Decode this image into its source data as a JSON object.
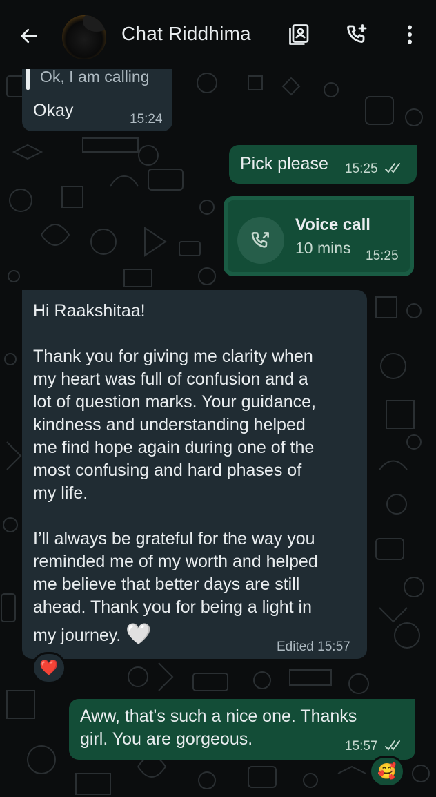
{
  "header": {
    "title": "Chat Riddhima"
  },
  "messages": {
    "m1": {
      "quoted_text": "Ok, I am calling",
      "text": "Okay",
      "time": "15:24"
    },
    "m2": {
      "text": "Pick please",
      "time": "15:25",
      "status": "read"
    },
    "m3": {
      "type": "voice-call",
      "title": "Voice call",
      "duration": "10 mins",
      "time": "15:25"
    },
    "m4": {
      "greeting": "Hi Raakshitaa!",
      "para1_lines": [
        "Thank you for giving me clarity when",
        "my heart was full of confusion and a",
        "lot of question marks. Your guidance,",
        "kindness and understanding helped",
        "me find hope again during one of the",
        "most confusing and hard phases of",
        "my life."
      ],
      "para2_lines": [
        "I’ll always be grateful for the way you",
        "reminded me of my worth and helped",
        "me believe that better days are still",
        "ahead. Thank you for being a light in",
        "my journey."
      ],
      "emoji": "🤍",
      "edited_time": "Edited 15:57",
      "reaction": "❤️"
    },
    "m5": {
      "lines": [
        "Aww, that's such a nice one. Thanks",
        "girl. You are gorgeous."
      ],
      "time": "15:57",
      "status": "delivered",
      "reaction": "🥰"
    }
  },
  "colors": {
    "background": "#0b0d0e",
    "incoming_bubble": "#202c33",
    "outgoing_bubble": "#134d37",
    "text": "#e9edef",
    "meta": "#aebac1"
  },
  "icons": {
    "back": "back-arrow-icon",
    "contact_card": "contact-card-icon",
    "add_call": "add-call-icon",
    "menu": "more-vert-icon",
    "voice_call": "outgoing-call-icon",
    "read_ticks": "double-check-icon"
  }
}
